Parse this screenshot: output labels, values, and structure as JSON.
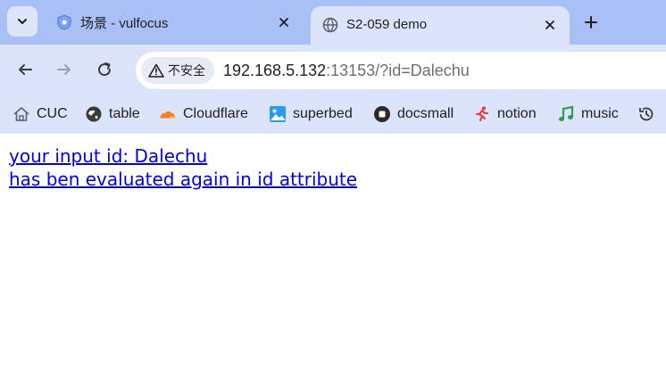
{
  "browser": {
    "tabs": [
      {
        "title": "场景 - vulfocus",
        "icon": "shield-icon",
        "active": false
      },
      {
        "title": "S2-059 demo",
        "icon": "globe-icon",
        "active": true
      }
    ],
    "toolbar": {
      "security_label": "不安全",
      "url_host": "192.168.5.132",
      "url_rest": ":13153/?id=Dalechu"
    },
    "bookmarks": [
      {
        "label": "CUC",
        "icon": "home-icon"
      },
      {
        "label": "table",
        "icon": "globe-icon"
      },
      {
        "label": "Cloudflare",
        "icon": "cloud-icon"
      },
      {
        "label": "superbed",
        "icon": "image-icon"
      },
      {
        "label": "docsmall",
        "icon": "square-icon"
      },
      {
        "label": "notion",
        "icon": "runner-icon"
      },
      {
        "label": "music",
        "icon": "music-note-icon"
      },
      {
        "label": "",
        "icon": "history-icon"
      }
    ],
    "colors": {
      "tabstrip": "#a8c0f5",
      "toolbar": "#dbe4fb",
      "link": "#0000ee"
    }
  },
  "page": {
    "line1": "your input id: Dalechu",
    "line2": "has ben evaluated again in id attribute"
  }
}
